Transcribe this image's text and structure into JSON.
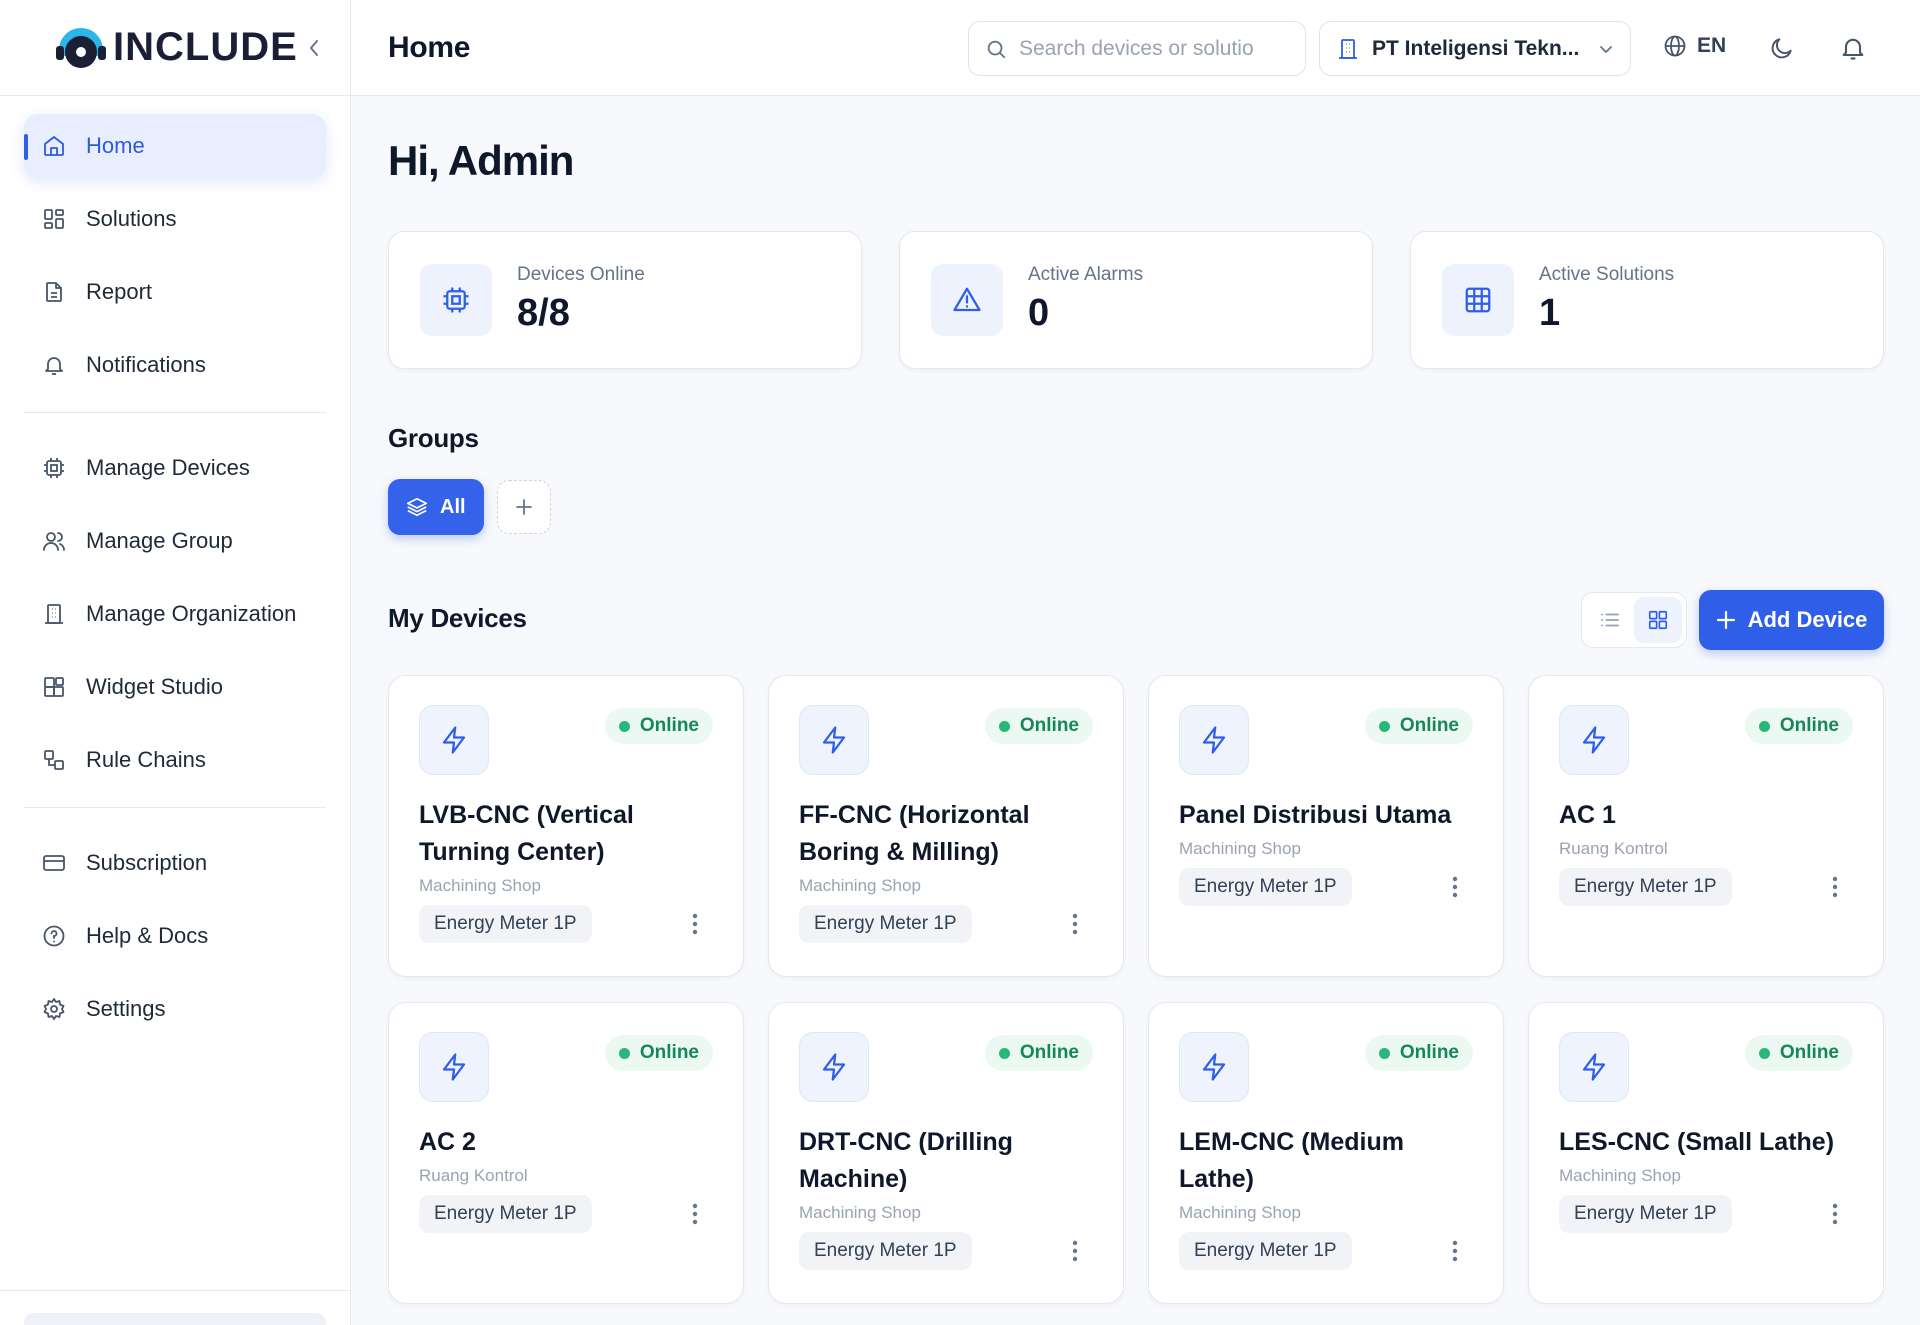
{
  "brand": {
    "name": "INCLUDE"
  },
  "sidebar": {
    "items": [
      {
        "label": "Home",
        "icon": "home-icon",
        "active": true
      },
      {
        "label": "Solutions",
        "icon": "solutions-icon"
      },
      {
        "label": "Report",
        "icon": "report-icon"
      },
      {
        "label": "Notifications",
        "icon": "bell-icon"
      },
      {
        "label": "Manage Devices",
        "icon": "chip-icon"
      },
      {
        "label": "Manage Group",
        "icon": "users-icon"
      },
      {
        "label": "Manage Organization",
        "icon": "building-icon"
      },
      {
        "label": "Widget Studio",
        "icon": "widget-icon"
      },
      {
        "label": "Rule Chains",
        "icon": "rule-chain-icon"
      },
      {
        "label": "Subscription",
        "icon": "card-icon"
      },
      {
        "label": "Help & Docs",
        "icon": "help-icon"
      },
      {
        "label": "Settings",
        "icon": "gear-icon"
      }
    ]
  },
  "header": {
    "title": "Home",
    "search_placeholder": "Search devices or solutio",
    "organization": "PT Inteligensi Tekn...",
    "language": "EN"
  },
  "main": {
    "greeting": "Hi, Admin",
    "stats": [
      {
        "label": "Devices Online",
        "value": "8/8",
        "icon": "chip-icon"
      },
      {
        "label": "Active Alarms",
        "value": "0",
        "icon": "alert-triangle-icon"
      },
      {
        "label": "Active Solutions",
        "value": "1",
        "icon": "grid-table-icon"
      }
    ],
    "groups_title": "Groups",
    "groups": [
      {
        "label": "All",
        "icon": "layers-icon",
        "active": true
      }
    ],
    "devices_title": "My Devices",
    "add_device_label": "Add Device",
    "devices": [
      {
        "name": "LVB-CNC (Vertical Turning Center)",
        "location": "Machining Shop",
        "type": "Energy Meter 1P",
        "status": "Online"
      },
      {
        "name": "FF-CNC (Horizontal Boring & Milling)",
        "location": "Machining Shop",
        "type": "Energy Meter 1P",
        "status": "Online"
      },
      {
        "name": "Panel Distribusi Utama",
        "location": "Machining Shop",
        "type": "Energy Meter 1P",
        "status": "Online"
      },
      {
        "name": "AC 1",
        "location": "Ruang Kontrol",
        "type": "Energy Meter 1P",
        "status": "Online"
      },
      {
        "name": "AC 2",
        "location": "Ruang Kontrol",
        "type": "Energy Meter 1P",
        "status": "Online"
      },
      {
        "name": "DRT-CNC (Drilling Machine)",
        "location": "Machining Shop",
        "type": "Energy Meter 1P",
        "status": "Online"
      },
      {
        "name": "LEM-CNC (Medium Lathe)",
        "location": "Machining Shop",
        "type": "Energy Meter 1P",
        "status": "Online"
      },
      {
        "name": "LES-CNC (Small Lathe)",
        "location": "Machining Shop",
        "type": "Energy Meter 1P",
        "status": "Online"
      }
    ]
  },
  "colors": {
    "accent": "#2f5fe8",
    "online": "#16875a",
    "online_bg": "#ecf8f2"
  }
}
